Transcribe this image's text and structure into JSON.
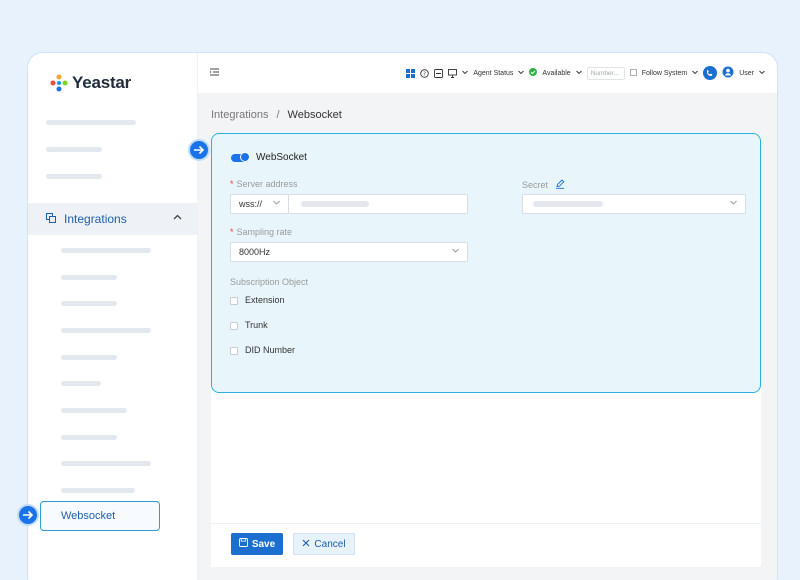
{
  "brand": {
    "name": "Yeastar"
  },
  "sidebar": {
    "active_group": {
      "label": "Integrations",
      "icon": "integrations-icon"
    },
    "active_item": {
      "label": "Websocket"
    }
  },
  "topbar": {
    "agent_status": "Agent Status",
    "available": "Available",
    "number_placeholder": "Number...",
    "follow_system": "Follow System",
    "user": "User"
  },
  "breadcrumb": {
    "parent": "Integrations",
    "separator": "/",
    "current": "Websocket"
  },
  "form": {
    "websocket_toggle_label": "WebSocket",
    "websocket_enabled": true,
    "server_address_label": "Server address",
    "server_prefix": "wss://",
    "secret_label": "Secret",
    "sampling_rate_label": "Sampling rate",
    "sampling_rate_value": "8000Hz",
    "subscription_label": "Subscription Object",
    "subscriptions": [
      {
        "label": "Extension",
        "checked": false
      },
      {
        "label": "Trunk",
        "checked": false
      },
      {
        "label": "DID Number",
        "checked": false
      }
    ],
    "required_mark": "*"
  },
  "footer": {
    "save_label": "Save",
    "cancel_label": "Cancel"
  },
  "colors": {
    "accent": "#1a6fcf",
    "highlight_border": "#2eaee0",
    "highlight_bg": "#e8f6fb",
    "page_bg": "#e8f2fd"
  }
}
